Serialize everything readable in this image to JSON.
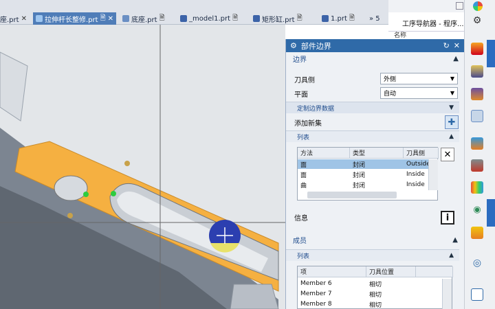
{
  "tabs": [
    {
      "label": "座.prt",
      "active": false
    },
    {
      "label": "拉伸杆长整修.prt",
      "active": true
    },
    {
      "label": "底座.prt",
      "active": false
    },
    {
      "label": "_model1.prt",
      "active": false
    },
    {
      "label": "矩形缸.prt",
      "active": false
    },
    {
      "label": "1.prt",
      "active": false
    },
    {
      "label": "» 5",
      "active": false
    }
  ],
  "navigator": {
    "title": "工序导航器 - 程序...",
    "column": "名称"
  },
  "dialog": {
    "title": "部件边界",
    "boundary_section": "边界",
    "tool_side_label": "刀具侧",
    "tool_side_value": "外侧",
    "plane_label": "平面",
    "plane_value": "自动",
    "custom_data": "定制边界数据",
    "add_new_set": "添加新集",
    "list_section": "列表",
    "list_columns": [
      "方法",
      "类型",
      "刀具侧"
    ],
    "list_rows": [
      {
        "method": "面",
        "type": "封闭",
        "side": "Outside"
      },
      {
        "method": "面",
        "type": "封闭",
        "side": "Inside"
      },
      {
        "method": "曲",
        "type": "封闭",
        "side": "Inside"
      }
    ],
    "info_label": "信息",
    "members_section": "成员",
    "members_list": "列表",
    "members_columns": [
      "项",
      "刀具位置"
    ],
    "members_rows": [
      {
        "item": "Member 6",
        "pos": "相切"
      },
      {
        "item": "Member 7",
        "pos": "相切"
      },
      {
        "item": "Member 8",
        "pos": "相切"
      }
    ]
  },
  "colors": {
    "accent": "#2f6aa8",
    "tab_active": "#4f7db8",
    "part": "#f5b041"
  }
}
